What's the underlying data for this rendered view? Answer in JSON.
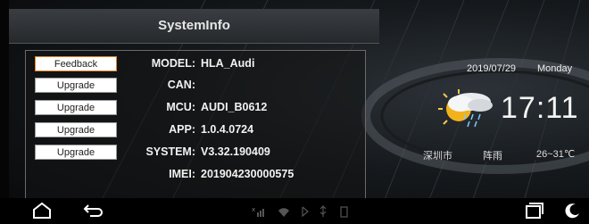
{
  "title": "SystemInfo",
  "buttons": [
    "Feedback",
    "Upgrade",
    "Upgrade",
    "Upgrade",
    "Upgrade"
  ],
  "info": [
    {
      "label": "MODEL:",
      "value": "HLA_Audi"
    },
    {
      "label": "CAN:",
      "value": ""
    },
    {
      "label": "MCU:",
      "value": "AUDI_B0612"
    },
    {
      "label": "APP:",
      "value": "1.0.4.0724"
    },
    {
      "label": "SYSTEM:",
      "value": "V3.32.190409"
    },
    {
      "label": "IMEI:",
      "value": "201904230000575"
    }
  ],
  "widget": {
    "date": "2019/07/29",
    "day": "Monday",
    "time": "17:11",
    "city": "深圳市",
    "condition": "阵雨",
    "temperature": "26~31℃"
  },
  "colors": {
    "accent": "#e2822a"
  }
}
